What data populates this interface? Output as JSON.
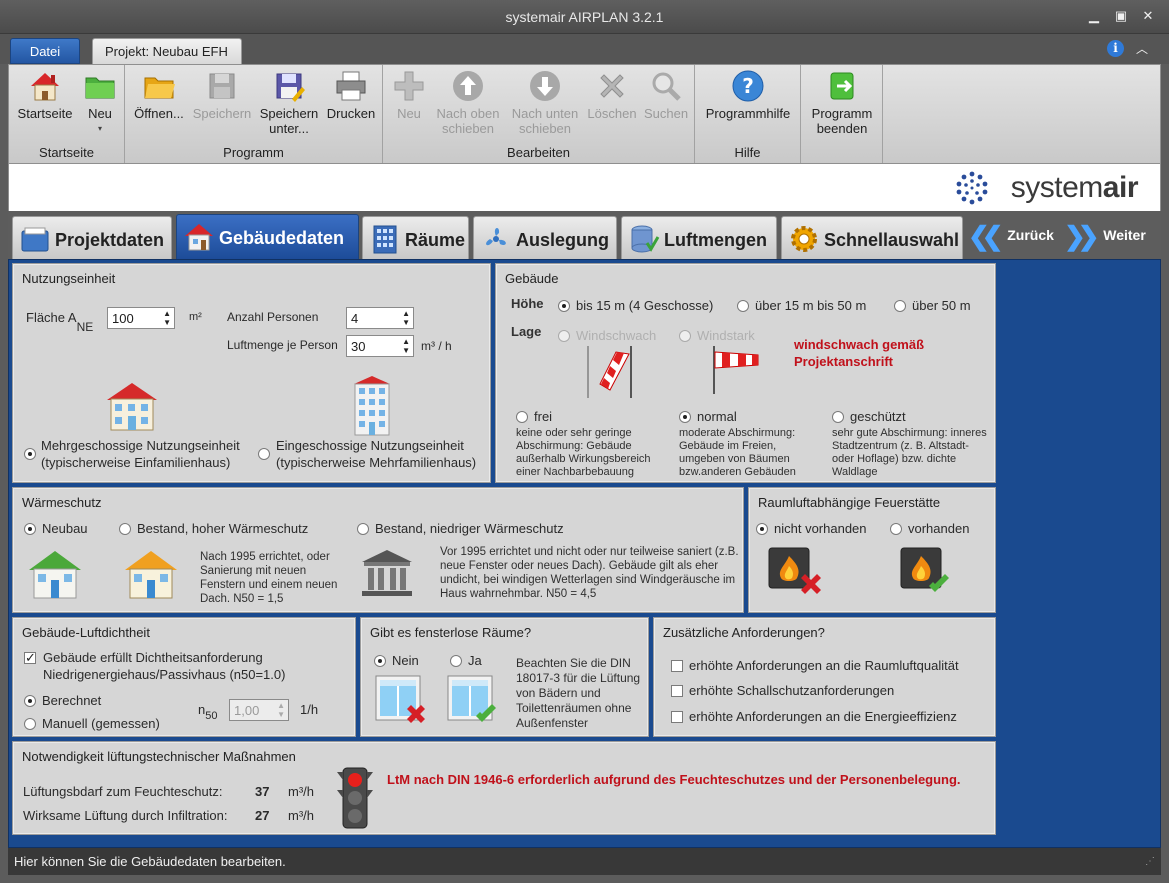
{
  "window": {
    "title": "systemair AIRPLAN 3.2.1"
  },
  "ribbon_tabs": {
    "file": "Datei",
    "project": "Projekt: Neubau EFH"
  },
  "ribbon": {
    "groups": {
      "startseite": "Startseite",
      "programm": "Programm",
      "bearbeiten": "Bearbeiten",
      "hilfe": "Hilfe"
    },
    "buttons": {
      "startseite": "Startseite",
      "neu": "Neu",
      "oeffnen": "Öffnen...",
      "speichern": "Speichern",
      "speichern_unter_1": "Speichern",
      "speichern_unter_2": "unter...",
      "drucken": "Drucken",
      "neu2": "Neu",
      "nach_oben_1": "Nach oben",
      "nach_oben_2": "schieben",
      "nach_unten_1": "Nach unten",
      "nach_unten_2": "schieben",
      "loeschen": "Löschen",
      "suchen": "Suchen",
      "programmhilfe": "Programmhilfe",
      "beenden_1": "Programm",
      "beenden_2": "beenden"
    }
  },
  "logo": {
    "text_light": "system",
    "text_bold": "air"
  },
  "main_tabs": {
    "projektdaten": "Projektdaten",
    "gebaeudedaten": "Gebäudedaten",
    "raeume": "Räume",
    "auslegung": "Auslegung",
    "luftmengen": "Luftmengen",
    "schnellauswahl": "Schnellauswahl",
    "zurueck": "Zurück",
    "weiter": "Weiter"
  },
  "nutzungseinheit": {
    "title": "Nutzungseinheit",
    "flaeche_label": "Fläche A",
    "flaeche_sub": "NE",
    "flaeche_value": "100",
    "flaeche_unit": "m²",
    "personen_label": "Anzahl Personen",
    "personen_value": "4",
    "luftmenge_label": "Luftmenge je Person",
    "luftmenge_value": "30",
    "luftmenge_unit": "m³ / h",
    "option1_line1": "Mehrgeschossige Nutzungseinheit",
    "option1_line2": "(typischerweise Einfamilienhaus)",
    "option2_line1": "Eingeschossige Nutzungseinheit",
    "option2_line2": "(typischerweise Mehrfamilienhaus)"
  },
  "gebaeude": {
    "title": "Gebäude",
    "hoehe_label": "Höhe",
    "hoehe_opt1": "bis 15 m (4 Geschosse)",
    "hoehe_opt2": "über 15 m bis 50 m",
    "hoehe_opt3": "über 50 m",
    "lage_label": "Lage",
    "lage_opt1": "Windschwach",
    "lage_opt2": "Windstark",
    "lage_note": "windschwach gemäß Projektanschrift",
    "frei": "frei",
    "frei_desc": "keine oder sehr geringe Abschirmung: Gebäude außerhalb Wirkungsbereich einer Nachbarbebauung",
    "normal": "normal",
    "normal_desc": "moderate Abschirmung: Gebäude im Freien, umgeben von Bäumen bzw.anderen Gebäuden",
    "geschuetzt": "geschützt",
    "geschuetzt_desc": "sehr gute Abschirmung: inneres Stadtzentrum (z. B. Altstadt- oder Hoflage) bzw. dichte Waldlage"
  },
  "waermeschutz": {
    "title": "Wärmeschutz",
    "neubau": "Neubau",
    "bestand_hoch": "Bestand, hoher Wärmeschutz",
    "bestand_niedrig": "Bestand, niedriger Wärmeschutz",
    "hoch_desc": "Nach 1995 errichtet, oder Sanierung mit neuen Fenstern und einem neuen Dach. N50 = 1,5",
    "niedrig_desc": "Vor 1995 errichtet und nicht oder nur teilweise saniert (z.B. neue Fenster oder neues Dach). Gebäude gilt als eher undicht, bei windigen Wetterlagen sind Windgeräusche im Haus wahrnehmbar. N50 = 4,5"
  },
  "feuerstaette": {
    "title": "Raumluftabhängige Feuerstätte",
    "nicht": "nicht vorhanden",
    "vorhanden": "vorhanden"
  },
  "luftdichtheit": {
    "title": "Gebäude-Luftdichtheit",
    "check_line1": "Gebäude erfüllt Dichtheitsanforderung",
    "check_line2": "Niedrigenergiehaus/Passivhaus (n50=1.0)",
    "berechnet": "Berechnet",
    "manuell": "Manuell (gemessen)",
    "n50_label": "n",
    "n50_sub": "50",
    "n50_value": "1,00",
    "n50_unit": "1/h"
  },
  "fensterlos": {
    "title": "Gibt es fensterlose Räume?",
    "nein": "Nein",
    "ja": "Ja",
    "note": "Beachten Sie die DIN 18017-3 für die Lüftung von Bädern und Toilettenräumen ohne Außenfenster"
  },
  "zusatz": {
    "title": "Zusätzliche Anforderungen?",
    "opt1": "erhöhte Anforderungen an die Raumluftqualität",
    "opt2": "erhöhte Schallschutzanforderungen",
    "opt3": "erhöhte Anforderungen an die Energieeffizienz"
  },
  "notwendigkeit": {
    "title": "Notwendigkeit lüftungstechnischer Maßnahmen",
    "row1_label": "Lüftungsbdarf zum Feuchteschutz:",
    "row1_value": "37",
    "row1_unit": "m³/h",
    "row2_label": "Wirksame Lüftung durch Infiltration:",
    "row2_value": "27",
    "row2_unit": "m³/h",
    "result": "LtM nach DIN 1946-6 erforderlich aufgrund des Feuchteschutzes und der Personenbelegung."
  },
  "status": {
    "text": "Hier können Sie die Gebäudedaten bearbeiten."
  }
}
